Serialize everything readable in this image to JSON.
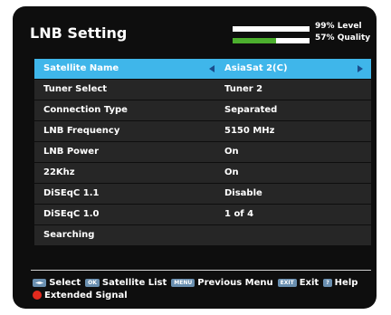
{
  "title": "LNB Setting",
  "meters": {
    "level": {
      "percent_text": "99%",
      "label": "Level",
      "fraction": 0.99,
      "fill_color": "#ffffff"
    },
    "quality": {
      "percent_text": "57%",
      "label": "Quality",
      "fraction": 0.57,
      "fill_color": "#4caf2e"
    }
  },
  "settings": [
    {
      "label": "Satellite Name",
      "value": "AsiaSat 2(C)"
    },
    {
      "label": "Tuner Select",
      "value": "Tuner 2"
    },
    {
      "label": "Connection Type",
      "value": "Separated"
    },
    {
      "label": "LNB Frequency",
      "value": "5150 MHz"
    },
    {
      "label": "LNB Power",
      "value": "On"
    },
    {
      "label": "22Khz",
      "value": "On"
    },
    {
      "label": "DiSEqC 1.1",
      "value": "Disable"
    },
    {
      "label": "DiSEqC 1.0",
      "value": "1 of 4"
    },
    {
      "label": "Searching",
      "value": ""
    }
  ],
  "help": {
    "select": {
      "key": "◄►",
      "label": "Select"
    },
    "satellite_list": {
      "key": "OK",
      "label": "Satellite List"
    },
    "previous_menu": {
      "key": "MENU",
      "label": "Previous Menu"
    },
    "exit": {
      "key": "EXIT",
      "label": "Exit"
    },
    "help_item": {
      "key": "?",
      "label": "Help"
    },
    "extended_signal": {
      "label": "Extended Signal"
    }
  },
  "colors": {
    "highlight": "#3fb6ea",
    "row_bg": "#262626",
    "background": "#0e0e0e"
  }
}
